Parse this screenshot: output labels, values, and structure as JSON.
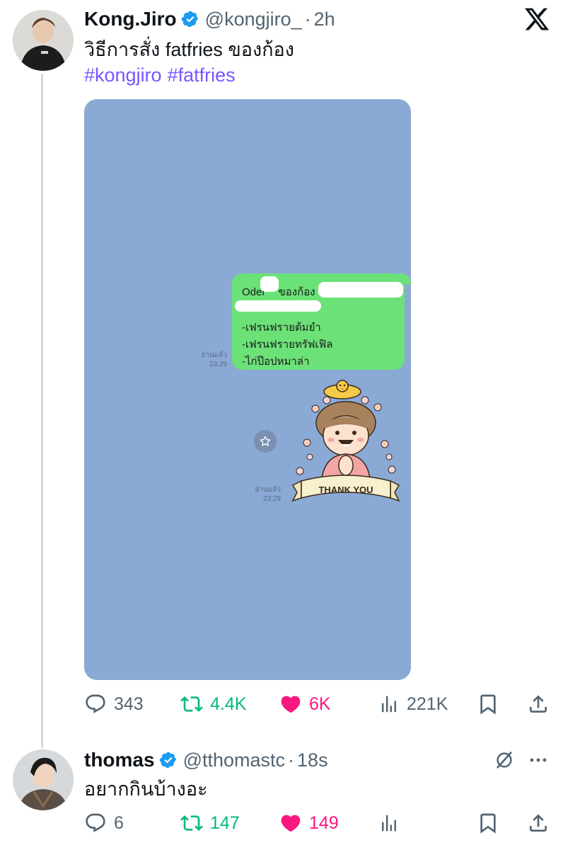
{
  "tweet1": {
    "author_name": "Kong.Jiro",
    "handle": "@kongjiro_",
    "separator": "·",
    "time": "2h",
    "text": "วิธีการสั่ง fatfries ของก้อง",
    "hashtags": [
      "#kongjiro",
      "#fatfries"
    ],
    "media": {
      "bubble_lines": [
        "Oder",
        "ของก้อง",
        "-เฟรนฟรายต้มยำ",
        "-เฟรนฟรายทรัฟเฟิล",
        "-ไก่ป๊อปหมาล่า"
      ],
      "read_label_1": "อ่านแล้ว",
      "read_time_1": "23:29",
      "read_label_2": "อ่านแล้ว",
      "read_time_2": "23:29",
      "sticker_text": "THANK YOU"
    },
    "stats": {
      "replies": "343",
      "retweets": "4.4K",
      "likes": "6K",
      "views": "221K"
    }
  },
  "tweet2": {
    "author_name": "thomas",
    "handle": "@tthomastc",
    "separator": "·",
    "time": "18s",
    "text": "อยากกินบ้างอะ",
    "stats": {
      "replies": "6",
      "retweets": "147",
      "likes": "149"
    }
  },
  "colors": {
    "hashtag": "#7856ff",
    "verified": "#1d9bf0",
    "retweet": "#00ba7c",
    "like": "#f91880",
    "media_bg": "#8aa9d5",
    "bubble": "#6ce178"
  }
}
